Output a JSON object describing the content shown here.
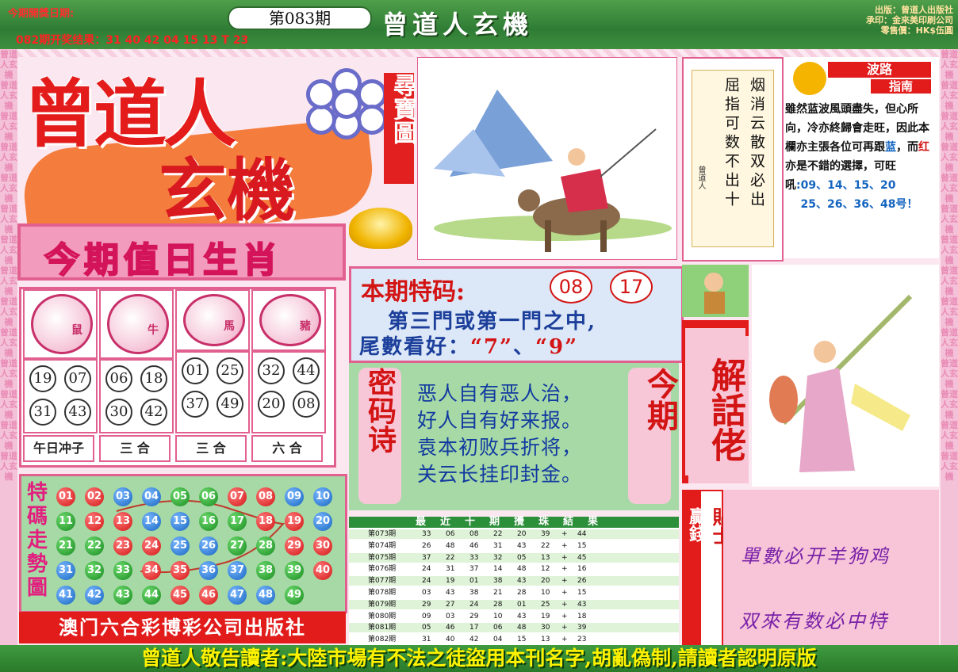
{
  "header": {
    "date_label": "今期開獎日期:",
    "issue": "第083期",
    "title": "曾道人玄機",
    "last_result": "082期开奖结果：31 40 42 04 15 13 T 23",
    "publisher_lines": [
      "出版：曾道人出版社",
      "承印：金來美印刷公司",
      "零售價：HK$伍圓"
    ]
  },
  "logo": {
    "line1": "曾道人",
    "line2": "玄機",
    "badge": "尋寶圖",
    "colors": {
      "red": "#e31b1b",
      "orange": "#f47c3c",
      "ring": "#6a6cc9"
    }
  },
  "side_text": "曾道人玄機",
  "zodiac": {
    "title": "今期值日生肖",
    "animals": [
      {
        "name": "鼠",
        "icon": "rat-icon",
        "numbers": [
          "19",
          "07",
          "31",
          "43"
        ],
        "label": "午日冲子"
      },
      {
        "name": "牛",
        "icon": "ox-icon",
        "numbers": [
          "06",
          "18",
          "30",
          "42"
        ],
        "label": "三 合"
      },
      {
        "name": "馬",
        "icon": "horse-icon",
        "numbers": [
          "01",
          "25",
          "37",
          "49"
        ],
        "label": "三 合"
      },
      {
        "name": "豬",
        "icon": "pig-icon",
        "numbers": [
          "32",
          "44",
          "20",
          "08"
        ],
        "label": "六 合"
      }
    ]
  },
  "trend": {
    "title": "特碼走勢圖",
    "balls": [
      [
        "01",
        "red"
      ],
      [
        "02",
        "red"
      ],
      [
        "03",
        "blue"
      ],
      [
        "04",
        "blue"
      ],
      [
        "05",
        "green"
      ],
      [
        "06",
        "green"
      ],
      [
        "07",
        "red"
      ],
      [
        "08",
        "red"
      ],
      [
        "09",
        "blue"
      ],
      [
        "10",
        "blue"
      ],
      [
        "11",
        "green"
      ],
      [
        "12",
        "red"
      ],
      [
        "13",
        "red"
      ],
      [
        "14",
        "blue"
      ],
      [
        "15",
        "blue"
      ],
      [
        "16",
        "green"
      ],
      [
        "17",
        "green"
      ],
      [
        "18",
        "red"
      ],
      [
        "19",
        "red"
      ],
      [
        "20",
        "blue"
      ],
      [
        "21",
        "green"
      ],
      [
        "22",
        "green"
      ],
      [
        "23",
        "red"
      ],
      [
        "24",
        "red"
      ],
      [
        "25",
        "blue"
      ],
      [
        "26",
        "blue"
      ],
      [
        "27",
        "green"
      ],
      [
        "28",
        "green"
      ],
      [
        "29",
        "red"
      ],
      [
        "30",
        "red"
      ],
      [
        "31",
        "blue"
      ],
      [
        "32",
        "green"
      ],
      [
        "33",
        "green"
      ],
      [
        "34",
        "red"
      ],
      [
        "35",
        "red"
      ],
      [
        "36",
        "blue"
      ],
      [
        "37",
        "blue"
      ],
      [
        "38",
        "green"
      ],
      [
        "39",
        "green"
      ],
      [
        "40",
        "red"
      ],
      [
        "41",
        "blue"
      ],
      [
        "42",
        "blue"
      ],
      [
        "43",
        "green"
      ],
      [
        "44",
        "green"
      ],
      [
        "45",
        "red"
      ],
      [
        "46",
        "red"
      ],
      [
        "47",
        "blue"
      ],
      [
        "48",
        "blue"
      ],
      [
        "49",
        "green"
      ]
    ],
    "colors": {
      "red": "#d31414",
      "blue": "#1565c0",
      "green": "#178a1f"
    }
  },
  "publisher": "澳门六合彩博彩公司出版社",
  "poem_box": {
    "col1": "烟消云散双必出",
    "col2": "屈指可数不出十",
    "signature": "曾道人"
  },
  "wave_guide": {
    "title1": "波路",
    "title2": "指南",
    "text_a": "雖然蓝波風頭盡失，但心所向，冷亦終歸會走旺，因此本欄亦主張各位可再跟",
    "blue_word": "蓝",
    "text_b": "，而",
    "red_word": "红",
    "text_c": "亦是不錯的選擇，可旺",
    "text_d": "吼",
    "numbers_line1": ":09、14、15、20",
    "numbers_line2": "25、26、36、48号！"
  },
  "special": {
    "title": "本期特码:",
    "num1": "08",
    "num2": "17",
    "line1": "第三門或第一門之中,",
    "line2_prefix": "尾數看好：",
    "tail1": "“7”",
    "sep": "、",
    "tail2": "“9”"
  },
  "code_poem": {
    "left_label": "密码诗",
    "right_label": "今期",
    "lines": [
      "恶人自有恶人治，",
      "好人自有好来报。",
      "袁本初败兵折将，",
      "关云长挂印封金。"
    ]
  },
  "results": {
    "title": "最近十期攪珠結果",
    "rows": [
      [
        "第073期",
        "33",
        "06",
        "08",
        "22",
        "20",
        "39",
        "+",
        "44"
      ],
      [
        "第074期",
        "26",
        "48",
        "46",
        "31",
        "43",
        "22",
        "+",
        "15"
      ],
      [
        "第075期",
        "37",
        "22",
        "33",
        "32",
        "05",
        "13",
        "+",
        "45"
      ],
      [
        "第076期",
        "24",
        "31",
        "37",
        "14",
        "48",
        "12",
        "+",
        "16"
      ],
      [
        "第077期",
        "24",
        "19",
        "01",
        "38",
        "43",
        "20",
        "+",
        "26"
      ],
      [
        "第078期",
        "03",
        "43",
        "38",
        "21",
        "28",
        "10",
        "+",
        "15"
      ],
      [
        "第079期",
        "29",
        "27",
        "24",
        "28",
        "01",
        "25",
        "+",
        "43"
      ],
      [
        "第080期",
        "09",
        "03",
        "29",
        "10",
        "43",
        "19",
        "+",
        "18"
      ],
      [
        "第081期",
        "05",
        "46",
        "17",
        "06",
        "48",
        "30",
        "+",
        "39"
      ],
      [
        "第082期",
        "31",
        "40",
        "42",
        "04",
        "15",
        "13",
        "+",
        "23"
      ]
    ]
  },
  "jiehua": "解話佬",
  "ying_qian": "贏錢",
  "tie_shi": "貼士",
  "tips": [
    "單數必开羊狗鸡",
    "双來有数必中特"
  ],
  "footer": "曾道人敬告讀者:大陸市場有不法之徒盜用本刊名字,胡亂偽制,請讀者認明原版"
}
